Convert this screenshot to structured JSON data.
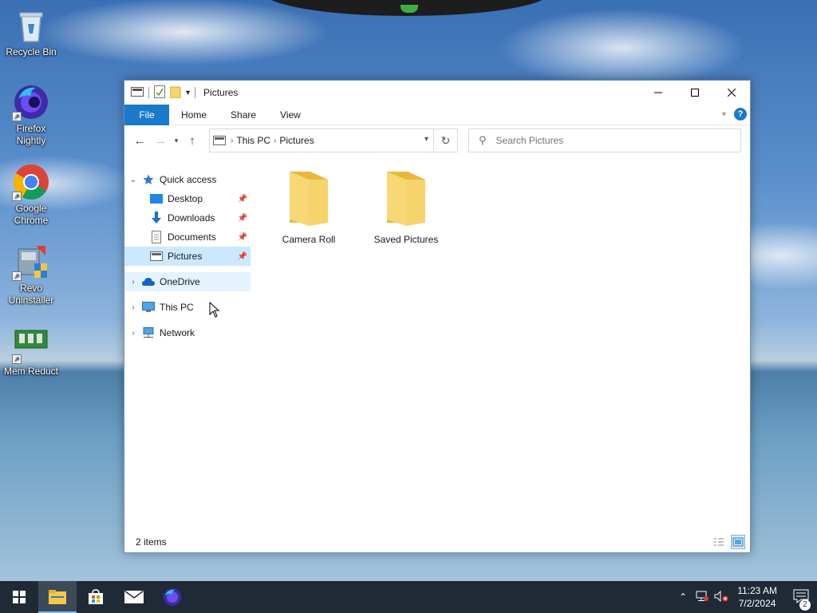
{
  "desktop": {
    "icons": [
      {
        "label": "Recycle Bin"
      },
      {
        "label": "Firefox Nightly"
      },
      {
        "label": "Google Chrome"
      },
      {
        "label": "Revo Uninstaller"
      },
      {
        "label": "Mem Reduct"
      }
    ]
  },
  "window": {
    "title": "Pictures",
    "ribbon_tabs": [
      "File",
      "Home",
      "Share",
      "View"
    ],
    "help_label": "?",
    "address": {
      "crumbs": [
        "This PC",
        "Pictures"
      ]
    },
    "search_placeholder": "Search Pictures",
    "nav": {
      "quick_access": "Quick access",
      "quick_items": [
        "Desktop",
        "Downloads",
        "Documents",
        "Pictures"
      ],
      "onedrive": "OneDrive",
      "this_pc": "This PC",
      "network": "Network"
    },
    "files": [
      {
        "name": "Camera Roll"
      },
      {
        "name": "Saved Pictures"
      }
    ],
    "status": "2 items"
  },
  "taskbar": {
    "time": "11:23 AM",
    "date": "7/2/2024",
    "notification_count": "2"
  },
  "colors": {
    "accent": "#1979ca",
    "folder": "#f6d36b",
    "selected": "#cce8ff",
    "taskbar": "#1f2a36"
  }
}
